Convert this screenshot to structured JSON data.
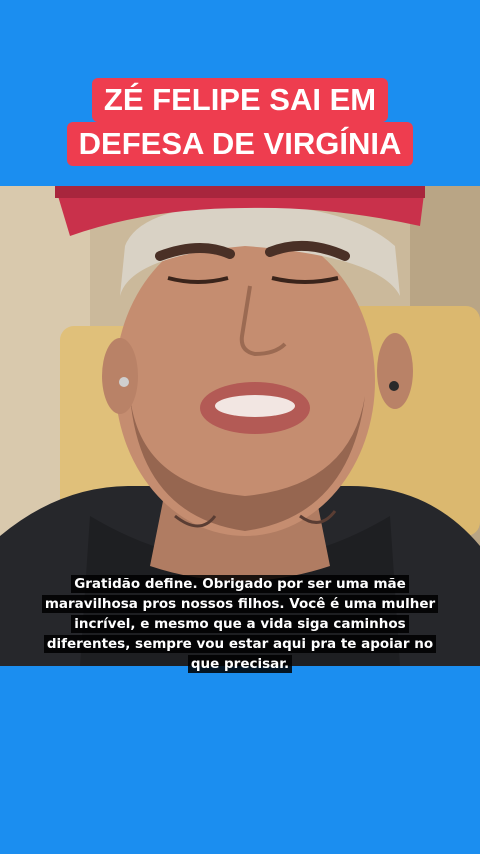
{
  "headline": {
    "line1": "ZÉ FELIPE SAI EM",
    "line2": "DEFESA DE VIRGÍNIA"
  },
  "caption": {
    "line1": "Gratidão define. Obrigado por ser uma mãe",
    "line2": "maravilhosa pros nossos filhos. Você é uma mulher",
    "line3": "incrível, e mesmo que a vida siga caminhos",
    "line4": "diferentes, sempre vou estar aqui pra te apoiar no",
    "line5": "que precisar."
  },
  "colors": {
    "background": "#1b8ef0",
    "headline_bg": "#ee3d4f",
    "caption_bg": "#000000"
  }
}
